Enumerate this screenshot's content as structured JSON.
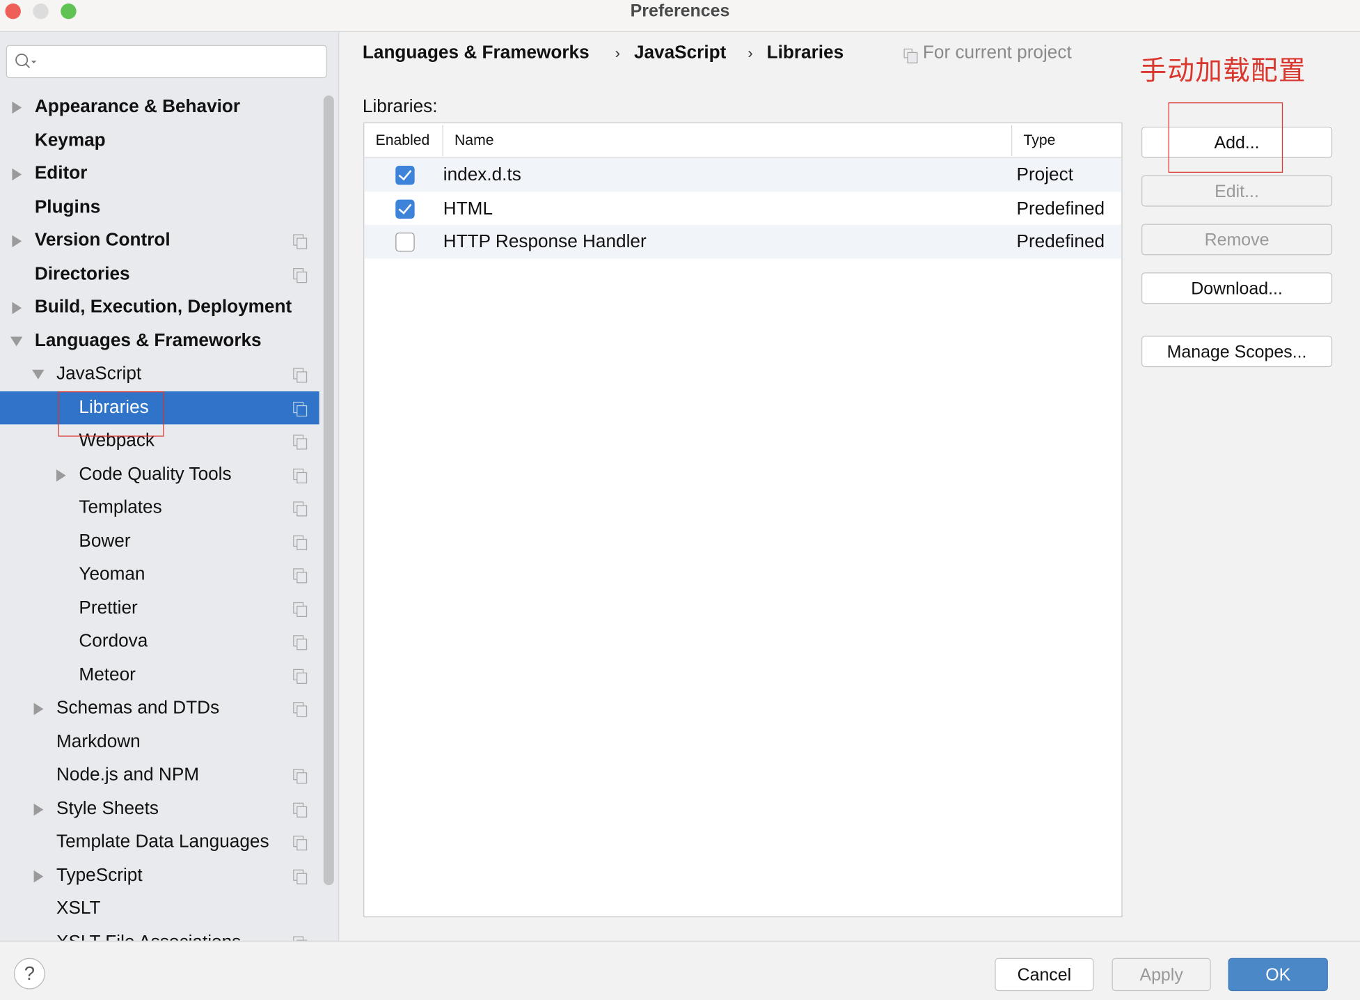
{
  "window": {
    "title": "Preferences",
    "traffic_lights": [
      "#ee5f57",
      "#dcdcdc",
      "#5fc353"
    ]
  },
  "search": {
    "placeholder": "",
    "icon": "search-icon"
  },
  "sidebar": {
    "items": [
      {
        "label": "Appearance & Behavior",
        "level": 0,
        "arrow": "right",
        "bold": true,
        "copy": false
      },
      {
        "label": "Keymap",
        "level": 0,
        "arrow": "",
        "bold": true,
        "copy": false
      },
      {
        "label": "Editor",
        "level": 0,
        "arrow": "right",
        "bold": true,
        "copy": false
      },
      {
        "label": "Plugins",
        "level": 0,
        "arrow": "",
        "bold": true,
        "copy": false
      },
      {
        "label": "Version Control",
        "level": 0,
        "arrow": "right",
        "bold": true,
        "copy": true
      },
      {
        "label": "Directories",
        "level": 0,
        "arrow": "",
        "bold": true,
        "copy": true
      },
      {
        "label": "Build, Execution, Deployment",
        "level": 0,
        "arrow": "right",
        "bold": true,
        "copy": false
      },
      {
        "label": "Languages & Frameworks",
        "level": 0,
        "arrow": "down",
        "bold": true,
        "copy": false
      },
      {
        "label": "JavaScript",
        "level": 1,
        "arrow": "down",
        "bold": false,
        "copy": true
      },
      {
        "label": "Libraries",
        "level": 2,
        "arrow": "",
        "bold": false,
        "copy": true,
        "selected": true
      },
      {
        "label": "Webpack",
        "level": 2,
        "arrow": "",
        "bold": false,
        "copy": true
      },
      {
        "label": "Code Quality Tools",
        "level": 2,
        "arrow": "right",
        "bold": false,
        "copy": true
      },
      {
        "label": "Templates",
        "level": 2,
        "arrow": "",
        "bold": false,
        "copy": true
      },
      {
        "label": "Bower",
        "level": 2,
        "arrow": "",
        "bold": false,
        "copy": true
      },
      {
        "label": "Yeoman",
        "level": 2,
        "arrow": "",
        "bold": false,
        "copy": true
      },
      {
        "label": "Prettier",
        "level": 2,
        "arrow": "",
        "bold": false,
        "copy": true
      },
      {
        "label": "Cordova",
        "level": 2,
        "arrow": "",
        "bold": false,
        "copy": true
      },
      {
        "label": "Meteor",
        "level": 2,
        "arrow": "",
        "bold": false,
        "copy": true
      },
      {
        "label": "Schemas and DTDs",
        "level": 1,
        "arrow": "right",
        "bold": false,
        "copy": true
      },
      {
        "label": "Markdown",
        "level": 1,
        "arrow": "",
        "bold": false,
        "copy": false
      },
      {
        "label": "Node.js and NPM",
        "level": 1,
        "arrow": "",
        "bold": false,
        "copy": true
      },
      {
        "label": "Style Sheets",
        "level": 1,
        "arrow": "right",
        "bold": false,
        "copy": true
      },
      {
        "label": "Template Data Languages",
        "level": 1,
        "arrow": "",
        "bold": false,
        "copy": true
      },
      {
        "label": "TypeScript",
        "level": 1,
        "arrow": "right",
        "bold": false,
        "copy": true
      },
      {
        "label": "XSLT",
        "level": 1,
        "arrow": "",
        "bold": false,
        "copy": false
      },
      {
        "label": "XSLT File Associations",
        "level": 1,
        "arrow": "",
        "bold": false,
        "copy": true
      }
    ]
  },
  "breadcrumb": [
    "Languages & Frameworks",
    "JavaScript",
    "Libraries"
  ],
  "scope_label": "For current project",
  "annotation": "手动加载配置",
  "libraries_label": "Libraries:",
  "table": {
    "headers": [
      "Enabled",
      "Name",
      "Type"
    ],
    "rows": [
      {
        "enabled": true,
        "name": "index.d.ts",
        "type": "Project"
      },
      {
        "enabled": true,
        "name": "HTML",
        "type": "Predefined"
      },
      {
        "enabled": false,
        "name": "HTTP Response Handler",
        "type": "Predefined"
      }
    ]
  },
  "buttons": {
    "add": "Add...",
    "edit": "Edit...",
    "remove": "Remove",
    "download": "Download...",
    "manage_scopes": "Manage Scopes..."
  },
  "footer": {
    "help": "?",
    "cancel": "Cancel",
    "apply": "Apply",
    "ok": "OK"
  },
  "colors": {
    "selection": "#2f74c8",
    "ok": "#4a88c8",
    "annotation": "#d9372d"
  }
}
